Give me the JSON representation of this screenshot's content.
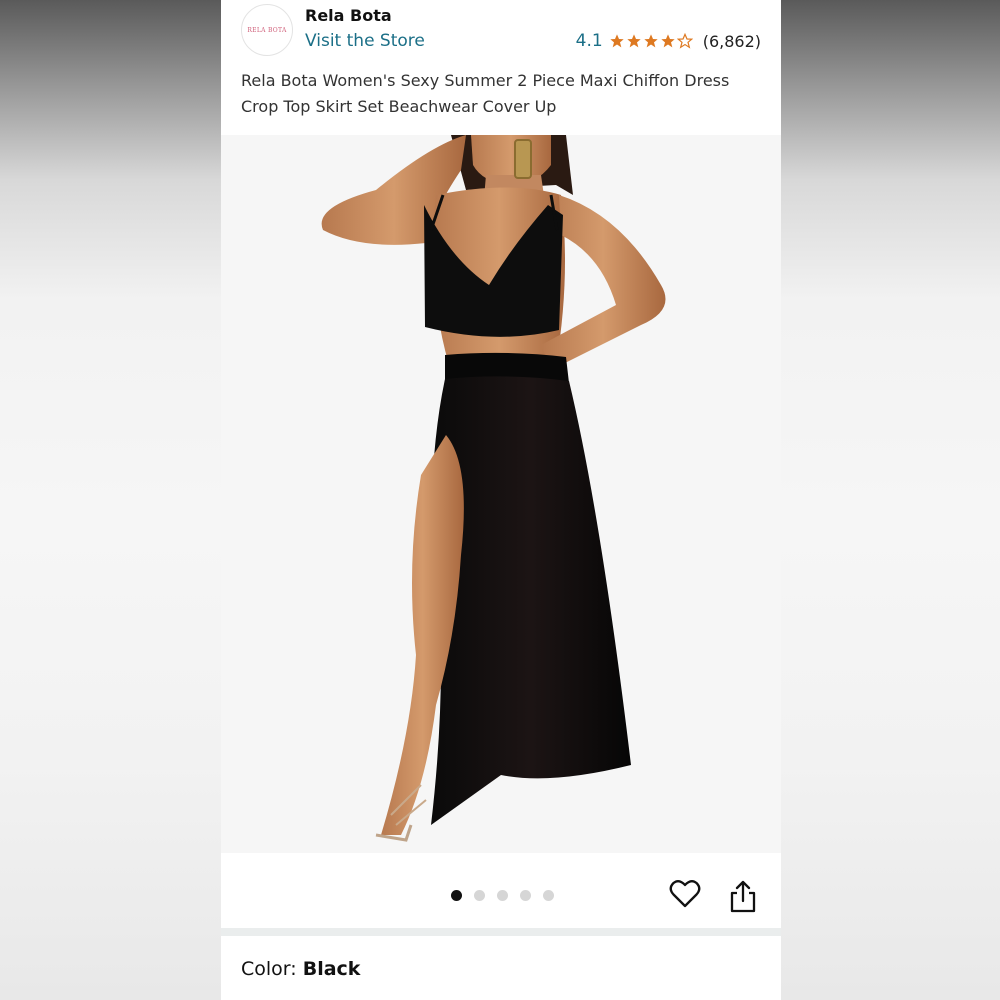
{
  "store": {
    "logo_text": "RELA BOTA",
    "name": "Rela Bota",
    "visit_label": "Visit the Store"
  },
  "rating": {
    "value": "4.1",
    "stars": 4.1,
    "count": "(6,862)",
    "star_color": "#de7921"
  },
  "product": {
    "title": "Rela Bota Women's Sexy Summer 2 Piece Maxi Chiffon Dress Crop Top Skirt Set Beachwear Cover Up"
  },
  "carousel": {
    "image_count": 5,
    "active_index": 0
  },
  "actions": {
    "like_icon": "heart-icon",
    "share_icon": "share-icon"
  },
  "color": {
    "label": "Color: ",
    "value": "Black"
  }
}
